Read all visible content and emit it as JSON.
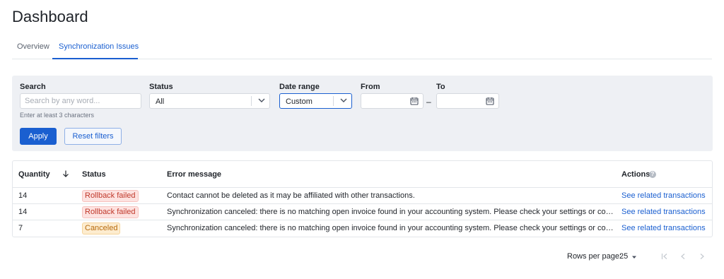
{
  "page": {
    "title": "Dashboard"
  },
  "tabs": [
    {
      "label": "Overview",
      "active": false
    },
    {
      "label": "Synchronization Issues",
      "active": true
    }
  ],
  "filters": {
    "search": {
      "label": "Search",
      "placeholder": "Search by any word...",
      "value": "",
      "hint": "Enter at least 3 characters"
    },
    "status": {
      "label": "Status",
      "value": "All"
    },
    "date_range": {
      "label": "Date range",
      "value": "Custom"
    },
    "from": {
      "label": "From",
      "value": ""
    },
    "to": {
      "label": "To",
      "value": ""
    },
    "separator": "–",
    "apply_label": "Apply",
    "reset_label": "Reset filters"
  },
  "table": {
    "columns": {
      "quantity": "Quantity",
      "status": "Status",
      "error": "Error message",
      "actions": "Actions"
    },
    "help_icon": "?",
    "rows": [
      {
        "quantity": "14",
        "status": "Rollback failed",
        "status_type": "failed",
        "error": "Contact cannot be deleted as it may be affiliated with other transactions.",
        "action": "See related transactions"
      },
      {
        "quantity": "14",
        "status": "Rollback failed",
        "status_type": "failed",
        "error": "Synchronization canceled: there is no matching open invoice found in your accounting system. Please check your settings or contact our support.",
        "action": "See related transactions"
      },
      {
        "quantity": "7",
        "status": "Canceled",
        "status_type": "canceled",
        "error": "Synchronization canceled: there is no matching open invoice found in your accounting system. Please check your settings or contact our support.",
        "action": "See related transactions"
      }
    ]
  },
  "pagination": {
    "rows_label": "Rows per page:",
    "rows_value": "25"
  },
  "colors": {
    "accent": "#1a5fd0",
    "failed_bg": "#fde2e0",
    "failed_text": "#c0392b",
    "canceled_bg": "#fdeccf",
    "canceled_text": "#b86a0c"
  }
}
